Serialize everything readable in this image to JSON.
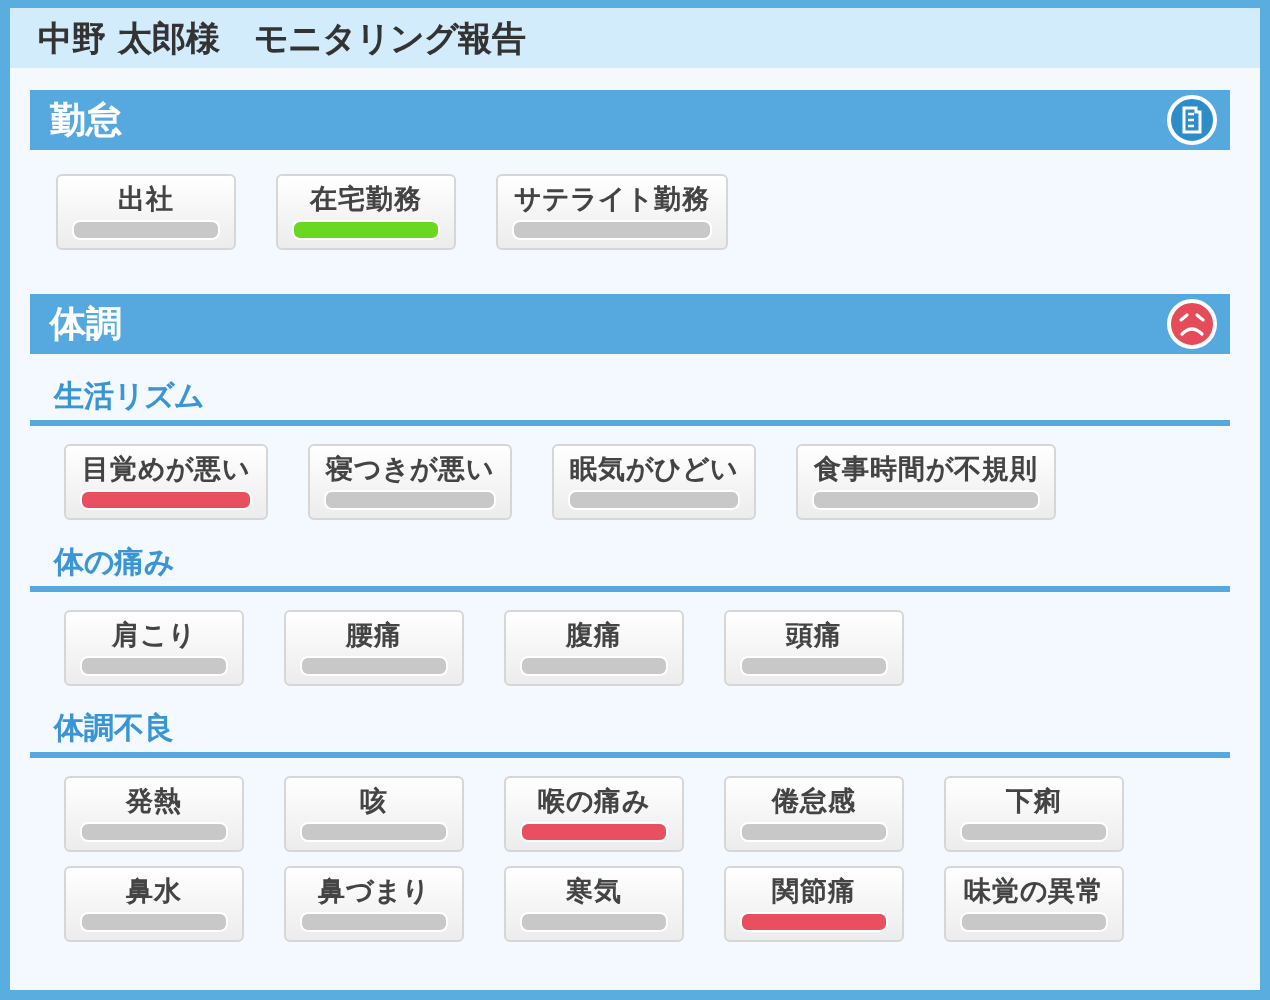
{
  "window": {
    "title": "中野 太郎様　モニタリング報告"
  },
  "sections": [
    {
      "title": "勤怠",
      "kind": "attendance",
      "color": "#6ad820",
      "groups": [
        {
          "items": [
            {
              "label": "出社",
              "selected": false
            },
            {
              "label": "在宅勤務",
              "selected": true
            },
            {
              "label": "サテライト勤務",
              "selected": false
            }
          ]
        }
      ]
    },
    {
      "title": "体調",
      "kind": "condition",
      "color": "#e85060",
      "groups": [
        {
          "heading": "生活リズム",
          "items": [
            {
              "label": "目覚めが悪い",
              "selected": true
            },
            {
              "label": "寝つきが悪い",
              "selected": false
            },
            {
              "label": "眠気がひどい",
              "selected": false
            },
            {
              "label": "食事時間が不規則",
              "selected": false
            }
          ]
        },
        {
          "heading": "体の痛み",
          "items": [
            {
              "label": "肩こり",
              "selected": false
            },
            {
              "label": "腰痛",
              "selected": false
            },
            {
              "label": "腹痛",
              "selected": false
            },
            {
              "label": "頭痛",
              "selected": false
            }
          ]
        },
        {
          "heading": "体調不良",
          "items": [
            {
              "label": "発熱",
              "selected": false
            },
            {
              "label": "咳",
              "selected": false
            },
            {
              "label": "喉の痛み",
              "selected": true
            },
            {
              "label": "倦怠感",
              "selected": false
            },
            {
              "label": "下痢",
              "selected": false
            },
            {
              "label": "鼻水",
              "selected": false
            },
            {
              "label": "鼻づまり",
              "selected": false
            },
            {
              "label": "寒気",
              "selected": false
            },
            {
              "label": "関節痛",
              "selected": true
            },
            {
              "label": "味覚の異常",
              "selected": false
            }
          ]
        }
      ]
    }
  ]
}
